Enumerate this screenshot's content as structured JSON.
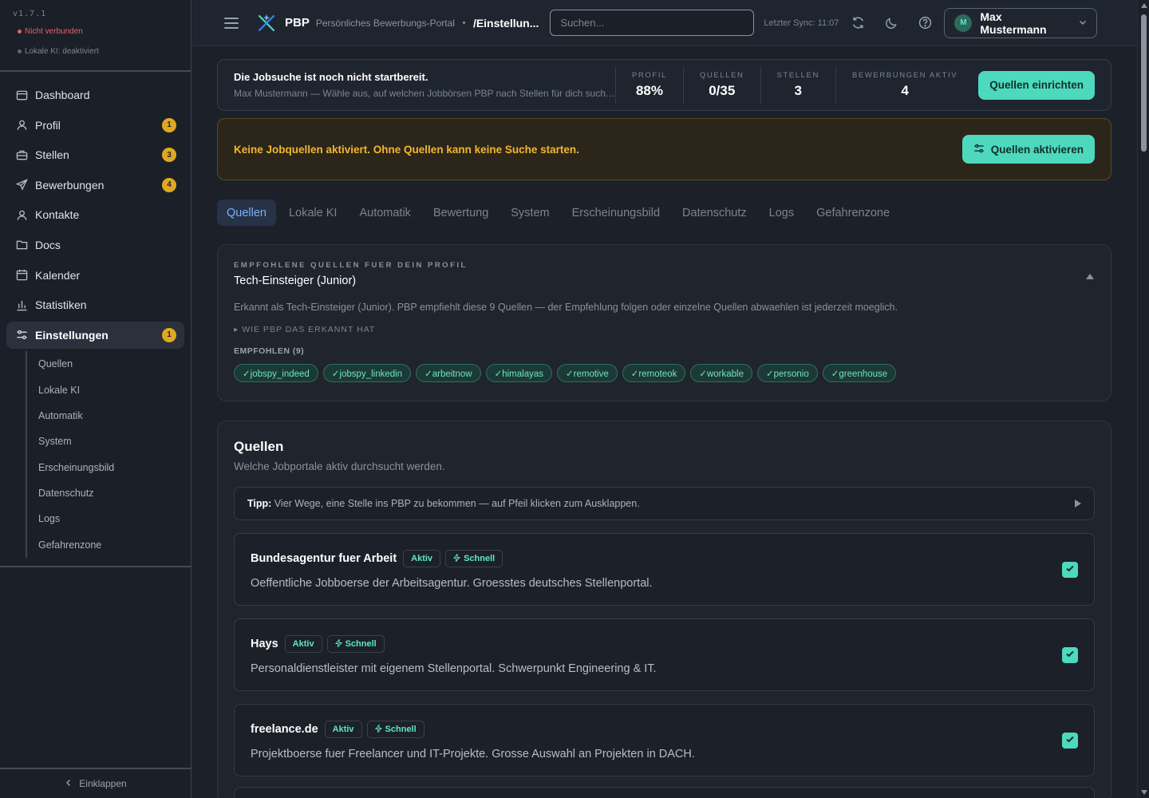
{
  "sidebar": {
    "version": "v1.7.1",
    "connection_status": "Nicht verbunden",
    "ki_status": "Lokale KI: deaktiviert",
    "items": [
      {
        "label": "Dashboard",
        "icon": "layout-icon",
        "badge": ""
      },
      {
        "label": "Profil",
        "icon": "user-icon",
        "badge": "1"
      },
      {
        "label": "Stellen",
        "icon": "briefcase-icon",
        "badge": "3"
      },
      {
        "label": "Bewerbungen",
        "icon": "send-icon",
        "badge": "4"
      },
      {
        "label": "Kontakte",
        "icon": "contacts-icon",
        "badge": ""
      },
      {
        "label": "Docs",
        "icon": "folder-icon",
        "badge": ""
      },
      {
        "label": "Kalender",
        "icon": "calendar-icon",
        "badge": ""
      },
      {
        "label": "Statistiken",
        "icon": "bar-chart-icon",
        "badge": ""
      },
      {
        "label": "Einstellungen",
        "icon": "sliders-icon",
        "badge": "1"
      }
    ],
    "subitems": [
      "Quellen",
      "Lokale KI",
      "Automatik",
      "System",
      "Erscheinungsbild",
      "Datenschutz",
      "Logs",
      "Gefahrenzone"
    ],
    "collapse_label": "Einklappen"
  },
  "header": {
    "brand": "PBP",
    "brand_sub": "Persönliches Bewerbungs-Portal",
    "breadcrumb": "/Einstellun...",
    "search_placeholder": "Suchen...",
    "sync": "Letzter Sync: 11:07",
    "user_initial": "M",
    "user_name": "Max Mustermann"
  },
  "readiness": {
    "title": "Die Jobsuche ist noch nicht startbereit.",
    "subtitle": "Max Mustermann — Wähle aus, auf welchen Jobbörsen PBP nach Stellen für dich suchen soll.",
    "stats": [
      {
        "label": "PROFIL",
        "value": "88%"
      },
      {
        "label": "QUELLEN",
        "value": "0/35"
      },
      {
        "label": "STELLEN",
        "value": "3"
      },
      {
        "label": "BEWERBUNGEN AKTIV",
        "value": "4"
      }
    ],
    "button": "Quellen einrichten"
  },
  "warning": {
    "text": "Keine Jobquellen aktiviert. Ohne Quellen kann keine Suche starten.",
    "button": "Quellen aktivieren"
  },
  "tabs": [
    "Quellen",
    "Lokale KI",
    "Automatik",
    "Bewertung",
    "System",
    "Erscheinungsbild",
    "Datenschutz",
    "Logs",
    "Gefahrenzone"
  ],
  "recommendation": {
    "kicker": "EMPFOHLENE QUELLEN FUER DEIN PROFIL",
    "title": "Tech-Einsteiger (Junior)",
    "description": "Erkannt als Tech-Einsteiger (Junior). PBP empfiehlt diese 9 Quellen — der Empfehlung folgen oder einzelne Quellen abwaehlen ist jederzeit moeglich.",
    "how": "▸ WIE PBP DAS ERKANNT HAT",
    "count_label": "EMPFOHLEN (9)",
    "chips": [
      "✓jobspy_indeed",
      "✓jobspy_linkedin",
      "✓arbeitnow",
      "✓himalayas",
      "✓remotive",
      "✓remoteok",
      "✓workable",
      "✓personio",
      "✓greenhouse"
    ]
  },
  "sources": {
    "title": "Quellen",
    "subtitle": "Welche Jobportale aktiv durchsucht werden.",
    "tip_bold": "Tipp:",
    "tip_text": " Vier Wege, eine Stelle ins PBP zu bekommen — auf Pfeil klicken zum Ausklappen.",
    "items": [
      {
        "name": "Bundesagentur fuer Arbeit",
        "status": "Aktiv",
        "speed": "Schnell",
        "description": "Oeffentliche Jobboerse der Arbeitsagentur. Groesstes deutsches Stellenportal.",
        "checked": true
      },
      {
        "name": "Hays",
        "status": "Aktiv",
        "speed": "Schnell",
        "description": "Personaldienstleister mit eigenem Stellenportal. Schwerpunkt Engineering & IT.",
        "checked": true
      },
      {
        "name": "freelance.de",
        "status": "Aktiv",
        "speed": "Schnell",
        "description": "Projektboerse fuer Freelancer und IT-Projekte. Grosse Auswahl an Projekten in DACH.",
        "checked": true
      }
    ]
  },
  "colors": {
    "accent": "#4dd9bd",
    "warning": "#f2b630",
    "danger": "#ef5b6b",
    "badge": "#e0a820",
    "tab_active": "#7db2f7"
  }
}
